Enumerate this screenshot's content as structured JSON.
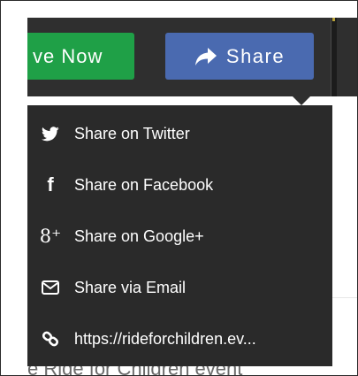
{
  "toolbar": {
    "give_label": "ve Now",
    "share_label": "Share"
  },
  "share_menu": {
    "items": [
      {
        "label": "Share on Twitter",
        "icon": "twitter-icon"
      },
      {
        "label": "Share on Facebook",
        "icon": "facebook-icon"
      },
      {
        "label": "Share on Google+",
        "icon": "google-plus-icon"
      },
      {
        "label": "Share via Email",
        "icon": "email-icon"
      },
      {
        "label": "https://rideforchildren.ev...",
        "icon": "link-icon"
      }
    ],
    "google_plus_glyph": "8⁺",
    "facebook_glyph": "f"
  },
  "background": {
    "partial_text": "e Ride for Children event"
  },
  "colors": {
    "give_button": "#1fa047",
    "share_button": "#4a6ab0",
    "menu_background": "#2a2a2a",
    "toolbar_background": "#2f2f2f"
  }
}
